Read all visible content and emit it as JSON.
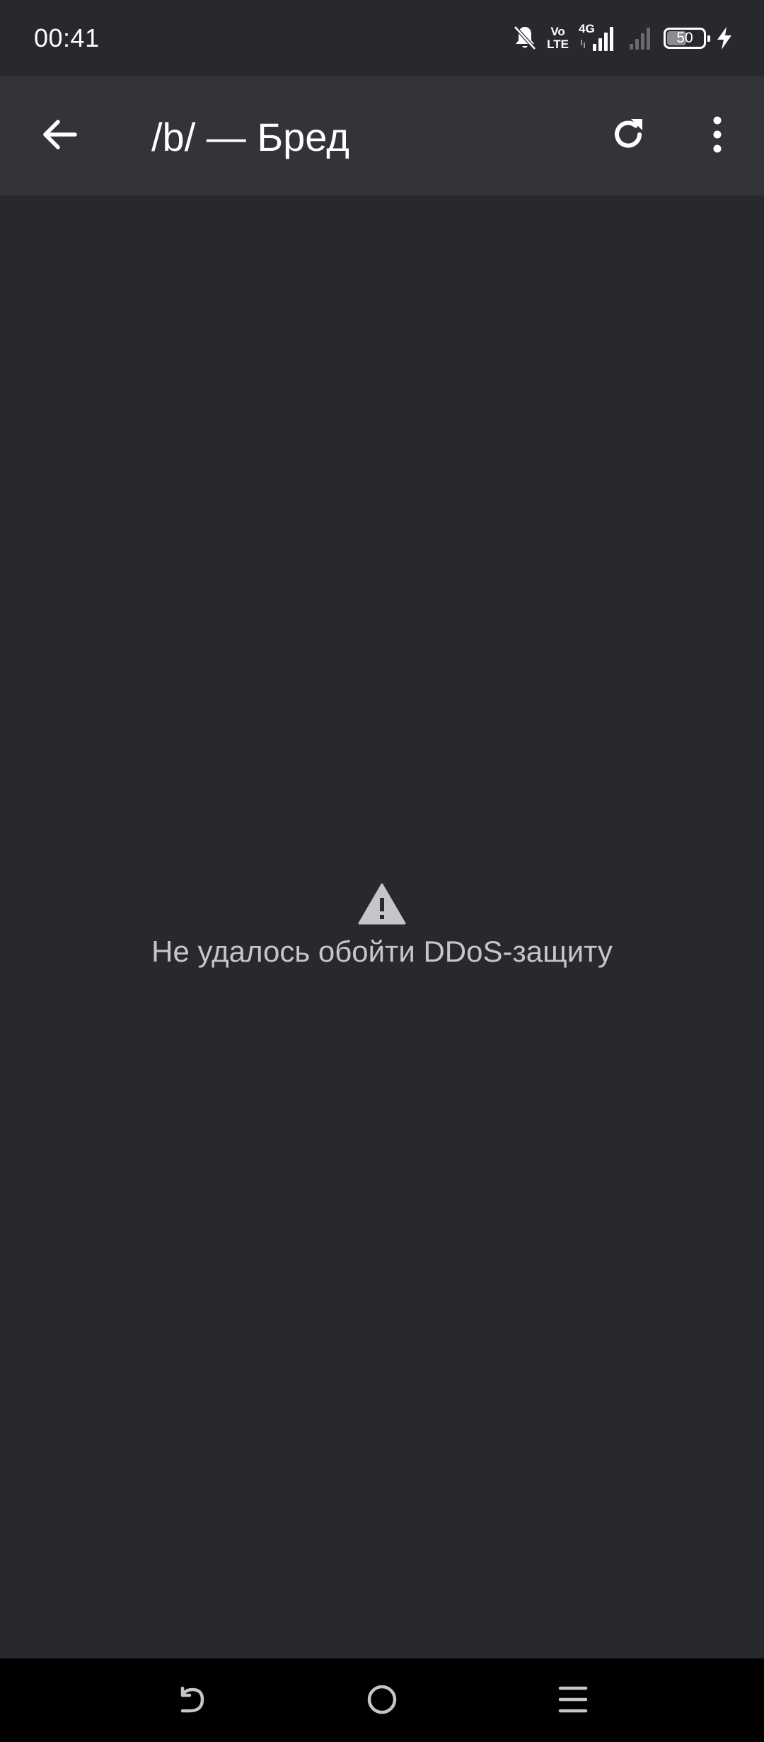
{
  "status_bar": {
    "time": "00:41",
    "volte_top": "Vo",
    "volte_bottom": "LTE",
    "network_type": "4G",
    "battery_level": "50",
    "icons": [
      "bell-off-icon",
      "volte-icon",
      "signal-4g-icon",
      "signal-icon",
      "battery-icon",
      "charging-icon"
    ]
  },
  "app_bar": {
    "title": "/b/ — Бред",
    "back_icon": "arrow-left-icon",
    "refresh_icon": "refresh-icon",
    "menu_icon": "more-vertical-icon"
  },
  "content": {
    "error_icon": "warning-icon",
    "error_message": "Не удалось обойти DDoS-защиту"
  },
  "nav_bar": {
    "icons": [
      "nav-back-icon",
      "nav-home-icon",
      "nav-recents-icon"
    ]
  },
  "colors": {
    "background": "#28292d",
    "app_bar": "#333438",
    "text_primary": "#ffffff",
    "text_secondary": "#c6c6c8",
    "nav_bar": "#000000"
  }
}
